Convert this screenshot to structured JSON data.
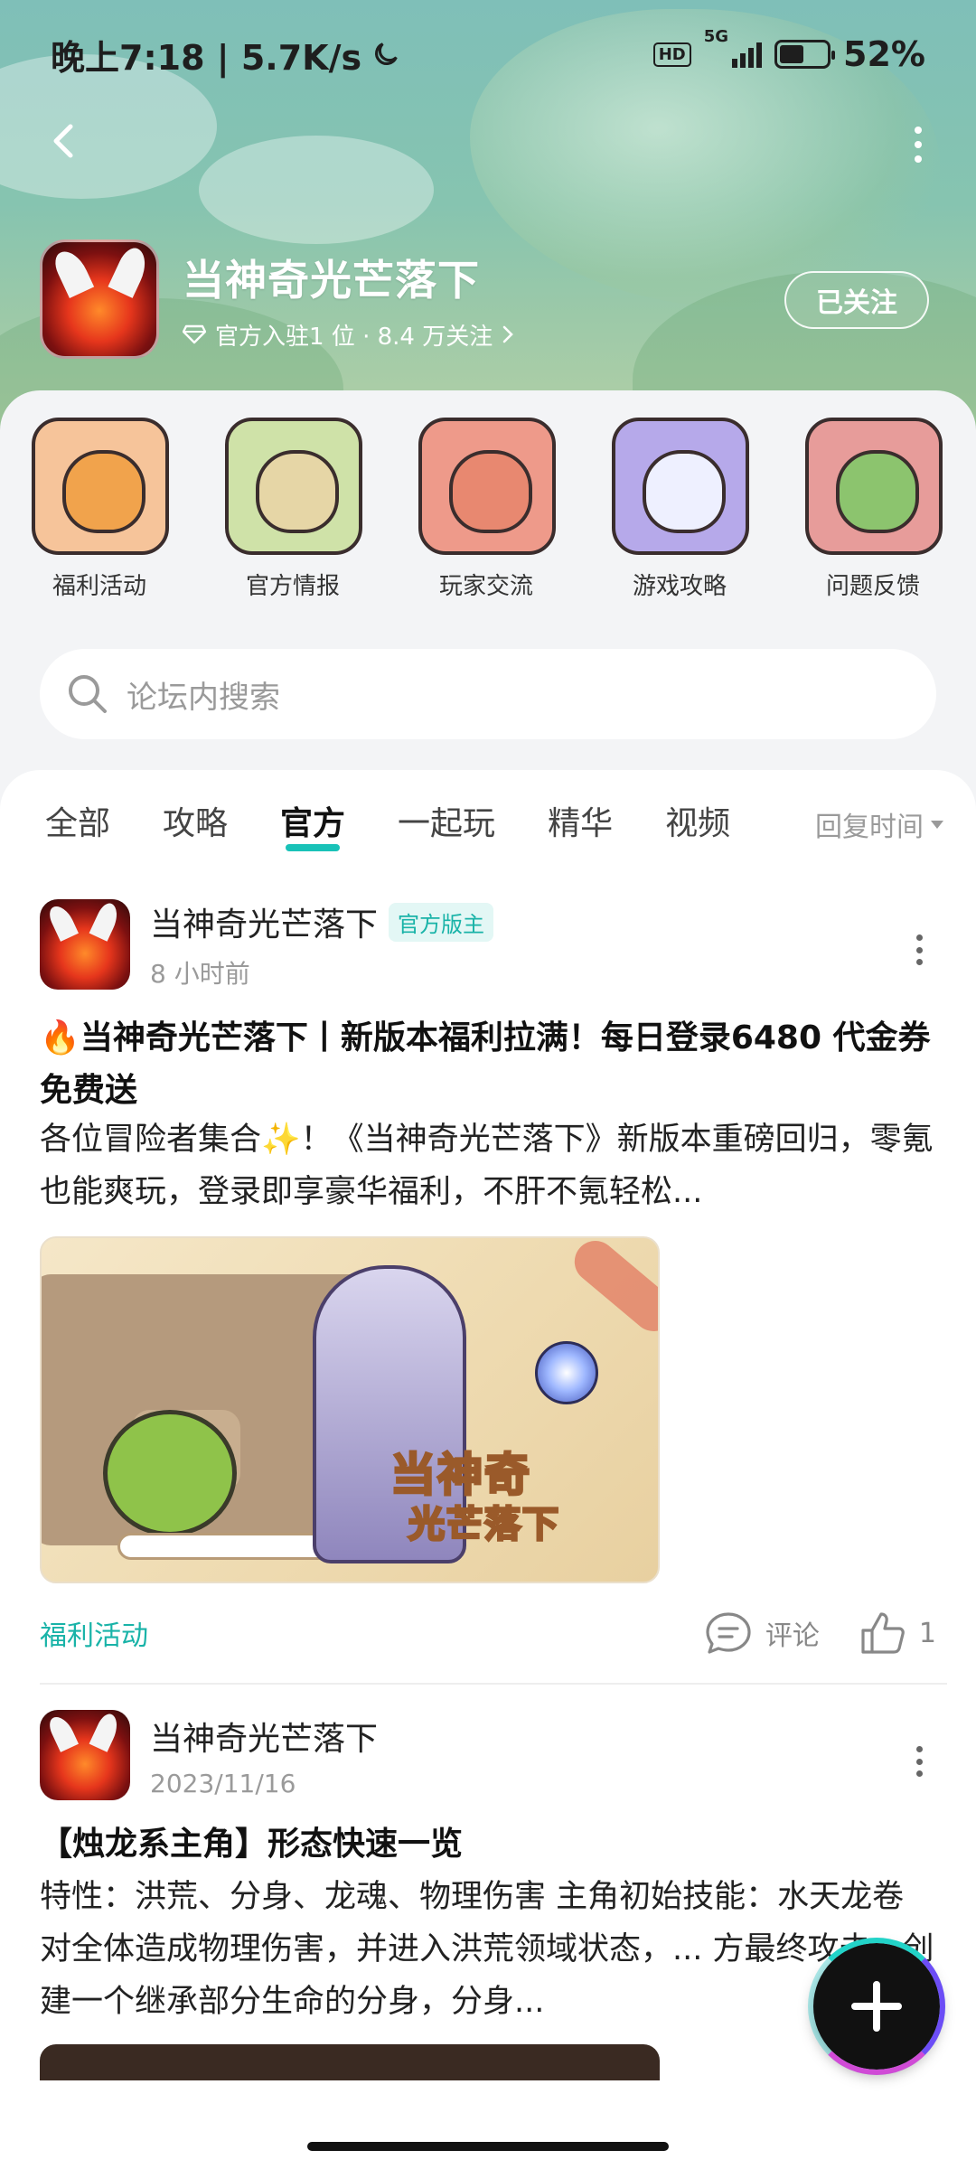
{
  "status_bar": {
    "time_text": "晚上7:18 | 5.7K/s",
    "network": "5G",
    "hd_label": "HD",
    "battery": "52%",
    "battery_level": 0.52
  },
  "forum": {
    "title": "当神奇光芒落下",
    "meta": "官方入驻1 位 · 8.4 万关注",
    "follow_label": "已关注"
  },
  "shortcuts": [
    {
      "label": "福利活动",
      "bg": "#f6c49a",
      "mascot": "#f1a34c"
    },
    {
      "label": "官方情报",
      "bg": "#cfe2a8",
      "mascot": "#e6d6a6"
    },
    {
      "label": "玩家交流",
      "bg": "#ee9a8a",
      "mascot": "#e88870"
    },
    {
      "label": "游戏攻略",
      "bg": "#b6a9ea",
      "mascot": "#eef0ff"
    },
    {
      "label": "问题反馈",
      "bg": "#e79c9a",
      "mascot": "#8cc46e"
    }
  ],
  "search": {
    "placeholder": "论坛内搜索"
  },
  "tabs": [
    "全部",
    "攻略",
    "官方",
    "一起玩",
    "精华",
    "视频"
  ],
  "active_tab": "官方",
  "sort_label": "回复时间",
  "posts": [
    {
      "author": "当神奇光芒落下",
      "badge": "官方版主",
      "time": "8 小时前",
      "title": "🔥当神奇光芒落下丨新版本福利拉满！每日登录6480 代金券免费送",
      "body": "各位冒险者集合✨！《当神奇光芒落下》新版本重磅回归，零氪也能爽玩，登录即享豪华福利，不肝不氪轻松...",
      "image_text_1": "当神奇",
      "image_text_2": "光芒落下",
      "tag": "福利活动",
      "comment_label": "评论",
      "likes": "1"
    },
    {
      "author": "当神奇光芒落下",
      "time": "2023/11/16",
      "title": "【烛龙系主角】形态快速一览",
      "body": "特性：洪荒、分身、龙魂、物理伤害 主角初始技能：水天龙卷 对全体造成物理伤害，并进入洪荒领域状态，... 方最终攻击，创建一个继承部分生命的分身，分身..."
    }
  ],
  "colors": {
    "accent": "#19c2b8",
    "text": "#222222",
    "muted": "#9a9a9a"
  }
}
